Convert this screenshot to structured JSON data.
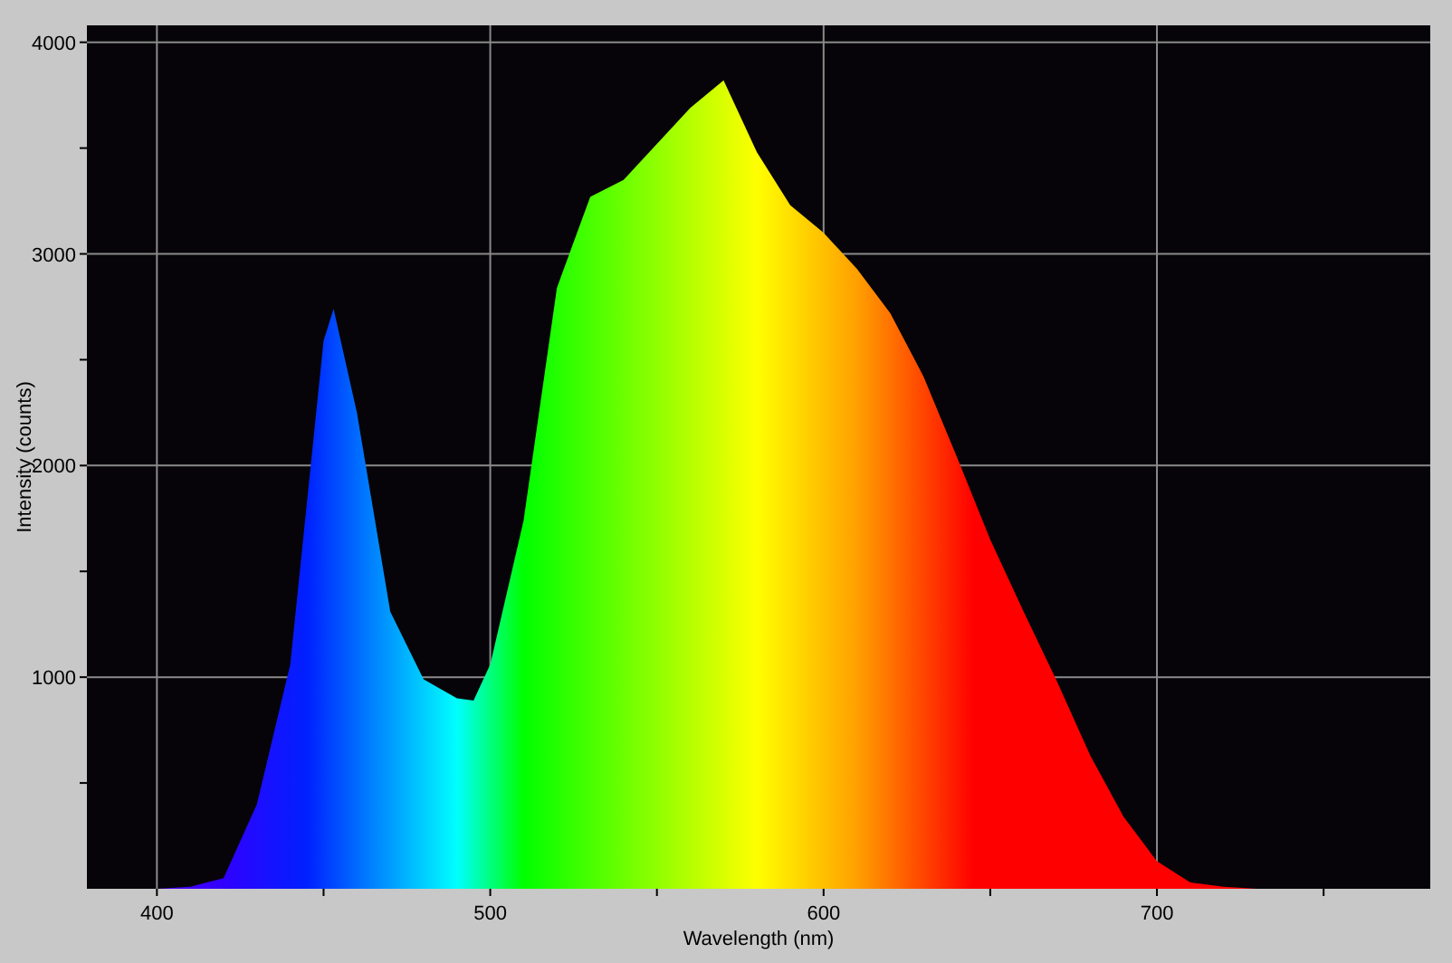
{
  "chart_data": {
    "type": "area",
    "xlabel": "Wavelength (nm)",
    "ylabel": "Intensity (counts)",
    "grid": true,
    "xlim": [
      379,
      782
    ],
    "ylim": [
      0,
      4080
    ],
    "xticks": [
      400,
      500,
      600,
      700
    ],
    "yticks": [
      1000,
      2000,
      3000,
      4000
    ],
    "x": [
      400,
      410,
      420,
      430,
      440,
      450,
      453,
      460,
      470,
      480,
      490,
      495,
      500,
      510,
      520,
      530,
      540,
      550,
      560,
      570,
      580,
      590,
      600,
      610,
      620,
      630,
      640,
      650,
      660,
      670,
      680,
      690,
      700,
      710,
      720,
      730,
      740
    ],
    "series": [
      {
        "values": [
          0,
          10,
          50,
          400,
          1060,
          2590,
          2740,
          2250,
          1310,
          990,
          900,
          890,
          1060,
          1740,
          2840,
          3270,
          3350,
          3520,
          3690,
          3820,
          3480,
          3230,
          3100,
          2930,
          2720,
          2420,
          2040,
          1650,
          1310,
          980,
          630,
          340,
          130,
          30,
          10,
          0,
          0
        ]
      }
    ]
  }
}
